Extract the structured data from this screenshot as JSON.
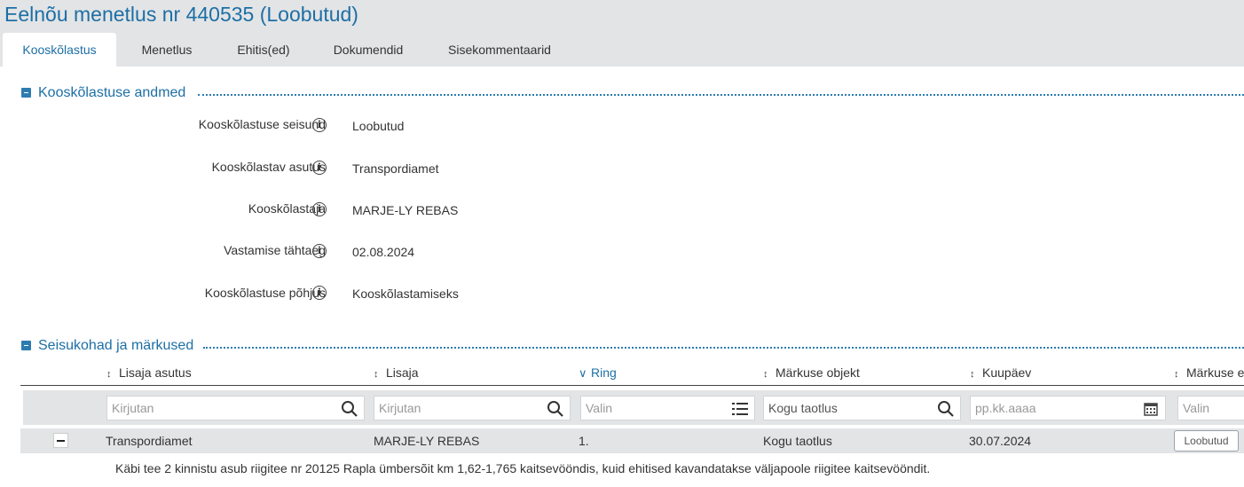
{
  "page": {
    "title": "Eelnõu menetlus nr 440535 (Loobutud)"
  },
  "tabs": [
    {
      "label": "Kooskõlastus",
      "active": true
    },
    {
      "label": "Menetlus",
      "active": false
    },
    {
      "label": "Ehitis(ed)",
      "active": false
    },
    {
      "label": "Dokumendid",
      "active": false
    },
    {
      "label": "Sisekommentaarid",
      "active": false
    }
  ],
  "section1": {
    "title": "Kooskõlastuse andmed",
    "fields": [
      {
        "label": "Kooskõlastuse seisund",
        "value": "Loobutud"
      },
      {
        "label": "Kooskõlastav asutus",
        "value": "Transpordiamet"
      },
      {
        "label": "Kooskõlastaja",
        "value": "MARJE-LY REBAS"
      },
      {
        "label": "Vastamise tähtaeg",
        "value": "02.08.2024"
      },
      {
        "label": "Kooskõlastuse põhjus",
        "value": "Kooskõlastamiseks"
      }
    ]
  },
  "section2": {
    "title": "Seisukohad ja märkused",
    "columns": [
      {
        "label": "Lisaja asutus"
      },
      {
        "label": "Lisaja"
      },
      {
        "label": "Ring",
        "sorted": true
      },
      {
        "label": "Märkuse objekt"
      },
      {
        "label": "Kuupäev"
      },
      {
        "label": "Märkuse e"
      }
    ],
    "filters": [
      {
        "value": "",
        "placeholder": "Kirjutan",
        "icon": "search-icon"
      },
      {
        "value": "",
        "placeholder": "Kirjutan",
        "icon": "search-icon"
      },
      {
        "value": "",
        "placeholder": "Valin",
        "icon": "list-icon"
      },
      {
        "value": "Kogu taotlus",
        "placeholder": "",
        "icon": "search-icon"
      },
      {
        "value": "",
        "placeholder": "pp.kk.aaaa",
        "icon": "calendar-icon"
      },
      {
        "value": "",
        "placeholder": "Valin",
        "icon": ""
      }
    ],
    "rows": [
      {
        "asutus": "Transpordiamet",
        "lisaja": "MARJE-LY REBAS",
        "ring": "1.",
        "objekt": "Kogu taotlus",
        "kuupaev": "30.07.2024",
        "status": "Loobutud",
        "comment": "Käbi tee 2 kinnistu asub riigitee nr 20125 Rapla ümbersõit km 1,62-1,765 kaitsevööndis, kuid ehitised kavandatakse väljapoole riigitee kaitsevööndit."
      }
    ]
  },
  "colors": {
    "accent": "#1d6fa5",
    "bar": "#e3e4e6"
  }
}
